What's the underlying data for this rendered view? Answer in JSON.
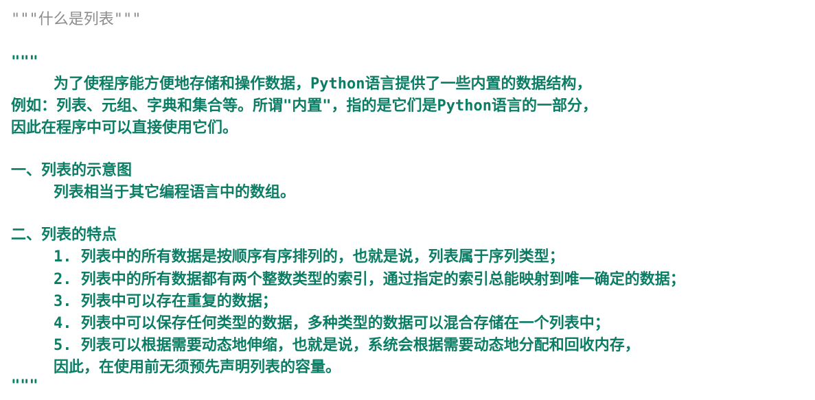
{
  "code": {
    "comment_line": "\"\"\"什么是列表\"\"\"",
    "docstring_open": "\"\"\"",
    "intro": [
      "为了使程序能方便地存储和操作数据，Python语言提供了一些内置的数据结构，",
      "例如：列表、元组、字典和集合等。所谓\"内置\"，指的是它们是Python语言的一部分，",
      "因此在程序中可以直接使用它们。"
    ],
    "section1": {
      "heading": "一、列表的示意图",
      "body": "列表相当于其它编程语言中的数组。"
    },
    "section2": {
      "heading": "二、列表的特点",
      "items": [
        "1. 列表中的所有数据是按顺序有序排列的，也就是说，列表属于序列类型；",
        "2. 列表中的所有数据都有两个整数类型的索引，通过指定的索引总能映射到唯一确定的数据；",
        "3. 列表中可以存在重复的数据；",
        "4. 列表中可以保存任何类型的数据，多种类型的数据可以混合存储在一个列表中；",
        "5. 列表可以根据需要动态地伸缩，也就是说，系统会根据需要动态地分配和回收内存，"
      ],
      "continuation": "因此，在使用前无须预先声明列表的容量。"
    },
    "docstring_close": "\"\"\""
  },
  "colors": {
    "comment": "#8c8c8c",
    "docstring": "#0b7d64",
    "background": "#ffffff"
  }
}
